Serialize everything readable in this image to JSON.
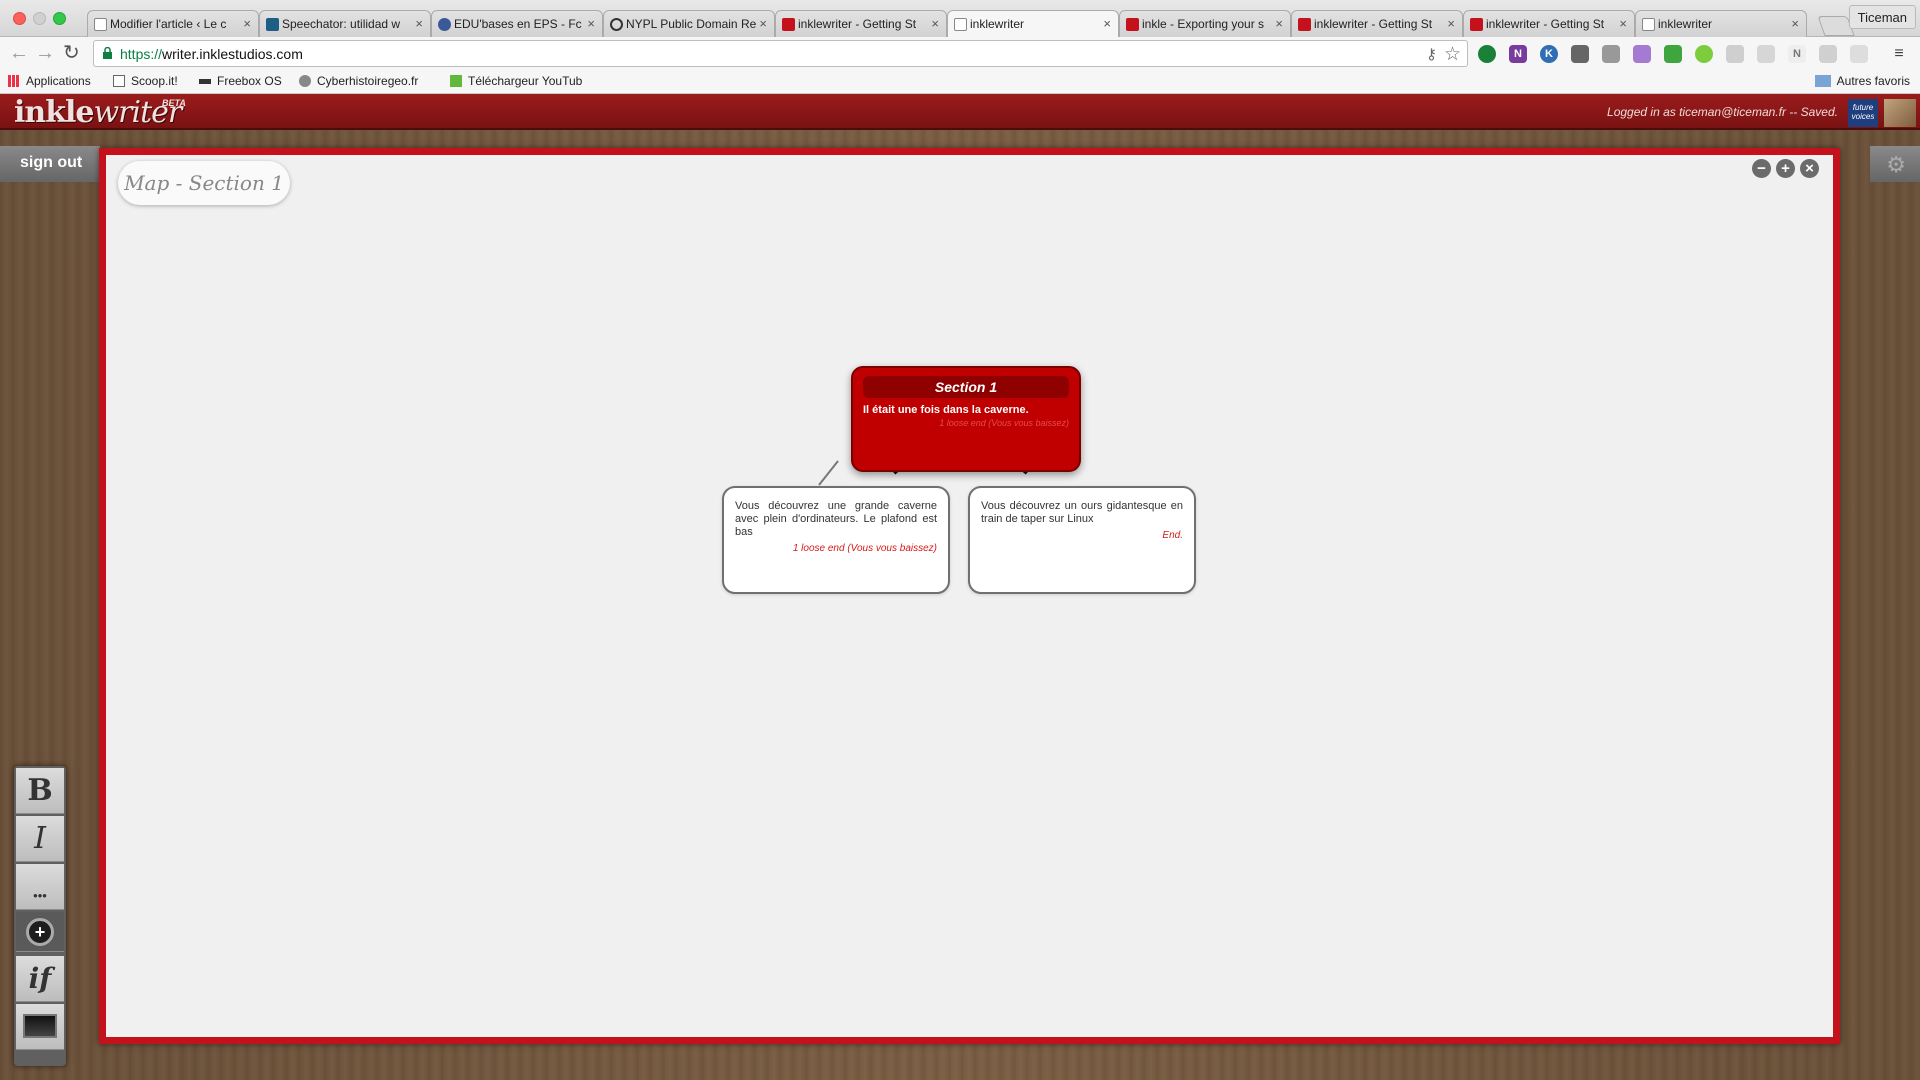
{
  "browser": {
    "tabs": [
      {
        "title": "Modifier l'article ‹ Le c",
        "icon_color": "#ffffff",
        "active": false
      },
      {
        "title": "Speechator: utilidad w",
        "icon_color": "#1c5e86",
        "active": false
      },
      {
        "title": "EDU'bases en EPS - Fc",
        "icon_color": "#3b5998",
        "active": false
      },
      {
        "title": "NYPL Public Domain Re",
        "icon_color": "#333333",
        "active": false
      },
      {
        "title": "inklewriter - Getting St",
        "icon_color": "#c4121d",
        "active": false
      },
      {
        "title": "inklewriter",
        "icon_color": "#ffffff",
        "active": true
      },
      {
        "title": "inkle - Exporting your s",
        "icon_color": "#c4121d",
        "active": false
      },
      {
        "title": "inklewriter - Getting St",
        "icon_color": "#c4121d",
        "active": false
      },
      {
        "title": "inklewriter - Getting St",
        "icon_color": "#c4121d",
        "active": false
      },
      {
        "title": "inklewriter",
        "icon_color": "#ffffff",
        "active": false
      }
    ],
    "profile_name": "Ticeman",
    "url_scheme": "https://",
    "url_rest": "writer.inklestudios.com",
    "bookmarks": [
      {
        "label": "Applications",
        "icon": "apps-grid-icon"
      },
      {
        "label": "Scoop.it!",
        "icon": "page-icon"
      },
      {
        "label": "Freebox OS",
        "icon": "freebox-icon"
      },
      {
        "label": "Cyberhistoiregeo.fr",
        "icon": "cyber-icon"
      },
      {
        "label": "Téléchargeur YouTub",
        "icon": "download-arrow-icon"
      }
    ],
    "other_bookmarks": "Autres favoris"
  },
  "app": {
    "logo": {
      "part1": "inkle",
      "part2": "writer",
      "badge": "BETA"
    },
    "status": "Logged in as ticeman@ticeman.fr -- Saved.",
    "partner_logo_text": "future voices",
    "sign_out": "sign out"
  },
  "map": {
    "title": "Map - Section 1",
    "zoom_out": "−",
    "zoom_in": "+",
    "close": "×",
    "main_node": {
      "title": "Section 1",
      "text": "Il était une fois dans la caverne.",
      "status": "1 loose end (Vous vous baissez)"
    },
    "child_nodes": [
      {
        "text": "Vous découvrez une grande caverne avec plein d'ordinateurs. Le plafond est bas",
        "status": "1 loose end (Vous vous baissez)"
      },
      {
        "text": "Vous découvrez un ours gidantesque en train de taper sur Linux",
        "status": "End."
      }
    ]
  },
  "palette": {
    "bold": "B",
    "italic": "I",
    "more": "•••",
    "add": "+",
    "if": "if"
  },
  "colors": {
    "accent_red": "#c4121d",
    "header_red": "#8b1717",
    "wood_brown": "#6e5440"
  }
}
